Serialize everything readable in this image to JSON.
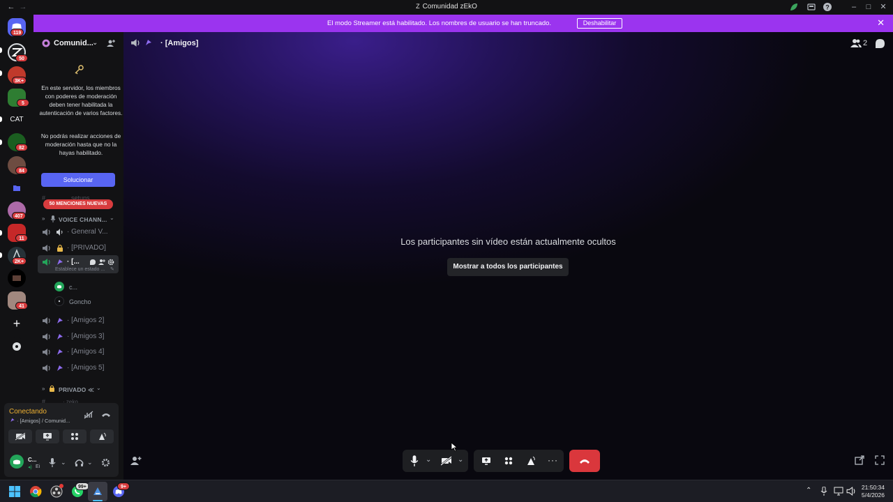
{
  "window": {
    "title": "Comunidad zEkO"
  },
  "banner": {
    "text": "El modo Streamer está habilitado. Los nombres de usuario se han truncado.",
    "button": "Deshabilitar"
  },
  "rail": {
    "badges": [
      "119",
      "50",
      "3K+",
      "5",
      "82",
      "84",
      "407",
      "11",
      "2K+",
      "41"
    ],
    "cat_label": "CAT"
  },
  "sidebar": {
    "server_name": "Comunid...",
    "notice_1": "En este servidor, los miembros con poderes de moderación deben tener habilitada la autenticación de varios factores.",
    "notice_2": "No podrás realizar acciones de moderación hasta que no la hayas habilitado.",
    "fix_button": "Solucionar",
    "truncated_channel": "setups",
    "mentions_badge": "50 MENCIONES NUEVAS",
    "category_voice": "VOICE CHANN...",
    "category_private": "PRIVADO ≪",
    "truncated_private_channel": "zeko",
    "channels": [
      {
        "label": "General V..."
      },
      {
        "label": "[PRIVADO]"
      },
      {
        "label": "[...",
        "status": "Establece un estado ..."
      },
      {
        "label": "[Amigos 2]"
      },
      {
        "label": "[Amigos 3]"
      },
      {
        "label": "[Amigos 4]"
      },
      {
        "label": "[Amigos 5]"
      }
    ],
    "users": [
      "c...",
      "Goncho"
    ]
  },
  "voice_panel": {
    "status": "Conectando",
    "subtitle": "[Amigos] / Comunid...",
    "user_name": "C...",
    "user_sub": "Ei"
  },
  "main": {
    "channel_title": "[Amigos]",
    "participant_count": "2",
    "hidden_message": "Los participantes sin vídeo están actualmente ocultos",
    "show_all_button": "Mostrar a todos los participantes"
  },
  "taskbar": {
    "time": "21:50:34",
    "date": "5/4/2026",
    "whatsapp_badge": "99+",
    "discord_badge": "9+"
  },
  "colors": {
    "accent": "#5865f2",
    "banner": "#9b34ef",
    "danger": "#da373c",
    "online": "#23a55a"
  }
}
